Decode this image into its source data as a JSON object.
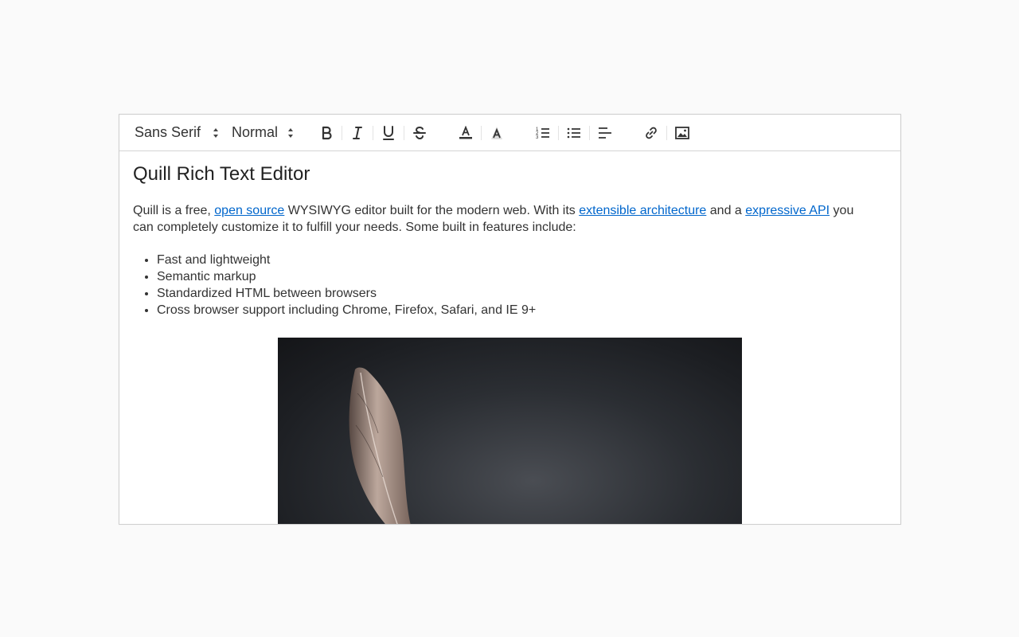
{
  "toolbar": {
    "font_value": "Sans Serif",
    "size_value": "Normal",
    "buttons": [
      "bold",
      "italic",
      "underline",
      "strike",
      "color",
      "background",
      "ordered-list",
      "bullet-list",
      "align",
      "link",
      "image"
    ]
  },
  "content": {
    "title": "Quill Rich Text Editor",
    "intro": {
      "t1": "Quill is a free, ",
      "link1": "open source",
      "t2": " WYSIWYG editor built for the modern web. With its ",
      "link2": "extensible architecture",
      "t3": " and a ",
      "link3": "expressive API",
      "t4": " you can completely customize it to fulfill your needs. Some built in features include:"
    },
    "features": [
      "Fast and lightweight",
      "Semantic markup",
      "Standardized HTML between browsers",
      "Cross browser support including Chrome, Firefox, Safari, and IE 9+"
    ]
  },
  "colors": {
    "link": "#0066cc",
    "border": "#cfcfcf",
    "background": "#fafafa"
  }
}
